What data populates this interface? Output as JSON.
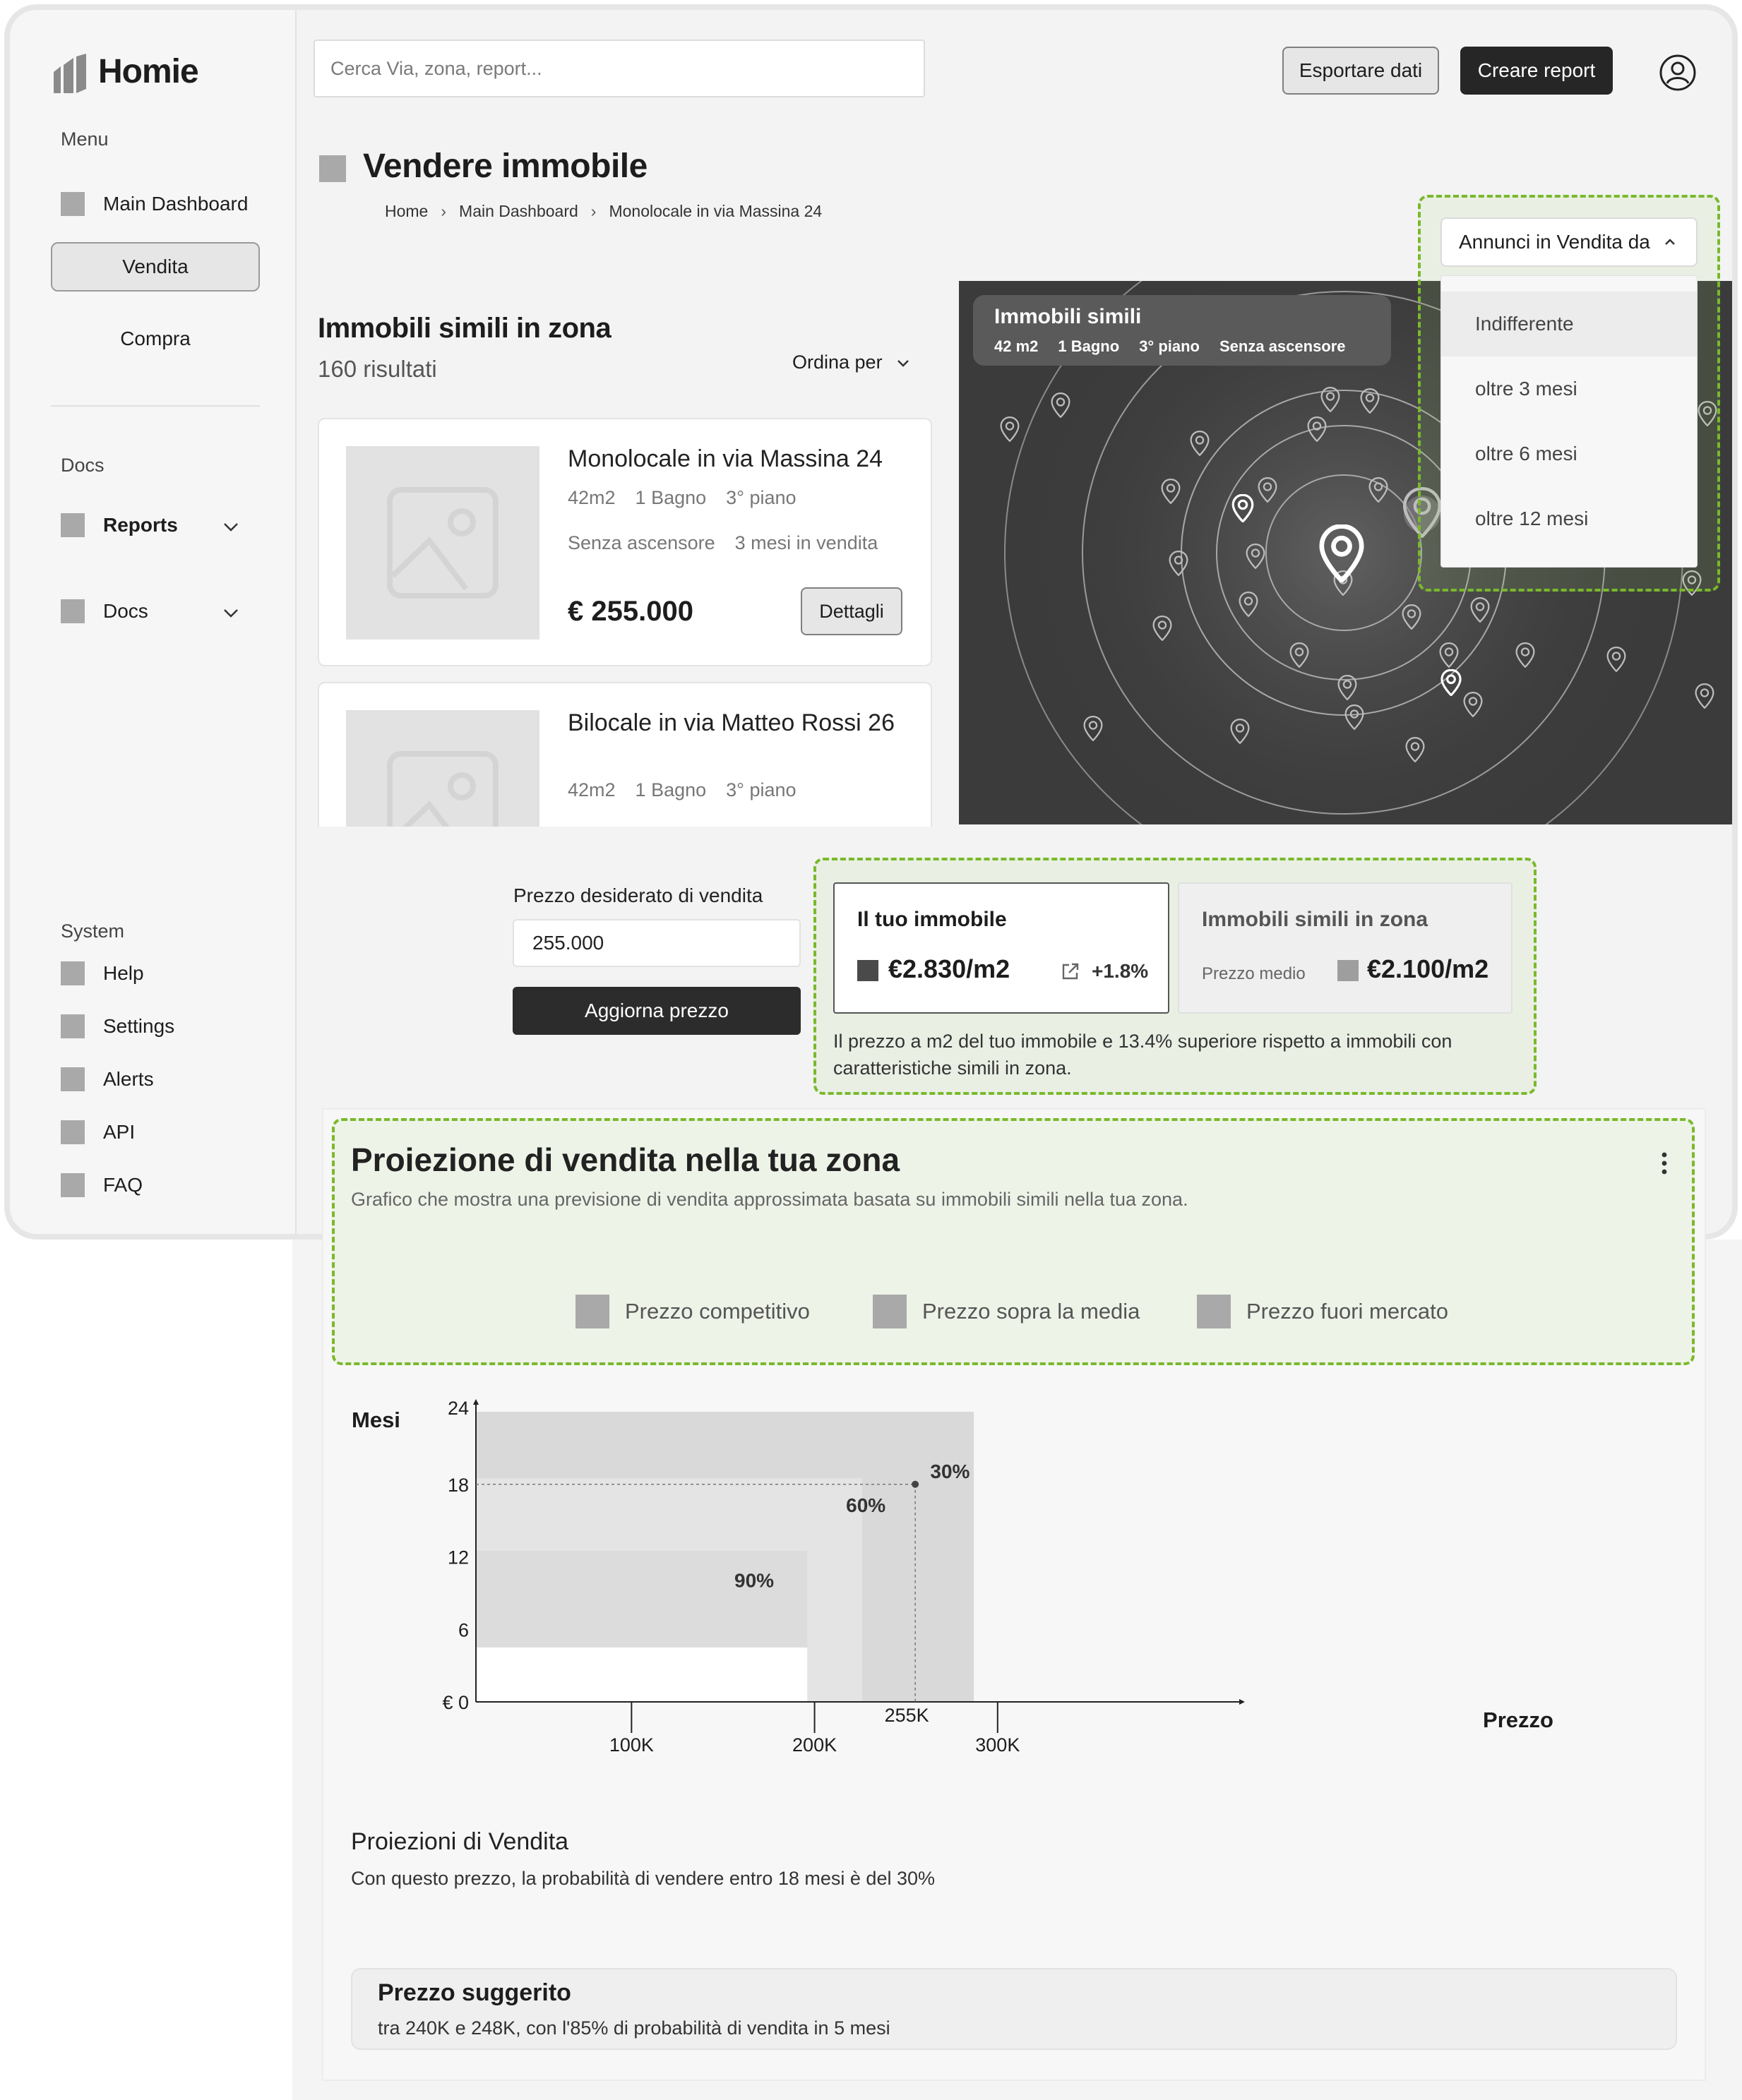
{
  "app": {
    "name": "Homie"
  },
  "sidebar": {
    "menu_label": "Menu",
    "items": [
      {
        "label": "Main Dashboard"
      },
      {
        "label": "Vendita"
      },
      {
        "label": "Compra"
      }
    ],
    "docs_label": "Docs",
    "docs_items": [
      {
        "label": "Reports"
      },
      {
        "label": "Docs"
      }
    ],
    "system_label": "System",
    "system_items": [
      {
        "label": "Help"
      },
      {
        "label": "Settings"
      },
      {
        "label": "Alerts"
      },
      {
        "label": "API"
      },
      {
        "label": "FAQ"
      }
    ]
  },
  "header": {
    "search_placeholder": "Cerca Via, zona, report...",
    "export_label": "Esportare dati",
    "report_label": "Creare report"
  },
  "page": {
    "title": "Vendere immobile",
    "breadcrumb": [
      "Home",
      "Main Dashboard",
      "Monolocale in via Massina 24"
    ]
  },
  "listing": {
    "title": "Immobili simili in zona",
    "results": "160 risultati",
    "sort_label": "Ordina per",
    "cards": [
      {
        "title": "Monolocale in via Massina 24",
        "size": "42m2",
        "bath": "1 Bagno",
        "floor": "3° piano",
        "elevator": "Senza ascensore",
        "months": "3 mesi in vendita",
        "price": "€ 255.000",
        "details": "Dettagli"
      },
      {
        "title": "Bilocale in via  Matteo Rossi 26",
        "size": "42m2",
        "bath": "1 Bagno",
        "floor": "3° piano"
      }
    ]
  },
  "map": {
    "card_title": "Immobili simili",
    "tags": [
      "42 m2",
      "1 Bagno",
      "3° piano",
      "Senza ascensore"
    ]
  },
  "filter": {
    "label": "Annunci in Vendita da",
    "options": [
      "Indifferente",
      "oltre 3 mesi",
      "oltre 6 mesi",
      "oltre 12 mesi"
    ],
    "highlighted": "Indifferente"
  },
  "pricing": {
    "input_label": "Prezzo desiderato di vendita",
    "input_value": "255.000",
    "update_label": "Aggiorna prezzo",
    "yours_title": "Il tuo immobile",
    "yours_value": "€2.830/m2",
    "yours_change": "+1.8%",
    "zone_title": "Immobili simili in zona",
    "zone_caption": "Prezzo medio",
    "zone_value": "€2.100/m2",
    "note": "Il prezzo a m2 del tuo immobile e 13.4% superiore rispetto a immobili con caratteristiche simili in zona."
  },
  "projection": {
    "title": "Proiezione di vendita nella tua zona",
    "subtitle": "Grafico che mostra una previsione di vendita approssimata basata su immobili simili nella tua zona.",
    "legend": [
      "Prezzo competitivo",
      "Prezzo sopra la media",
      "Prezzo fuori mercato"
    ],
    "summary_title": "Proiezioni di Vendita",
    "summary_text": "Con questo prezzo, la probabilità di vendere entro 18 mesi è del 30%",
    "suggested_title": "Prezzo suggerito",
    "suggested_text": "tra 240K e 248K, con l'85% di probabilità di vendita in 5 mesi"
  },
  "chart_data": {
    "type": "area",
    "xlabel": "Prezzo",
    "ylabel": "Mesi",
    "x_ticks": [
      "100K",
      "200K",
      "300K"
    ],
    "x_tick_values": [
      100,
      200,
      300
    ],
    "y_ticks": [
      "€ 0",
      "6",
      "12",
      "18",
      "24"
    ],
    "y_tick_values": [
      0,
      6,
      12,
      18,
      24
    ],
    "xlim": [
      15,
      378
    ],
    "ylim": [
      0,
      24
    ],
    "bands": [
      {
        "label": "90%",
        "x_end": 196,
        "y_min": 4.5,
        "y_max": 12.5,
        "x_label": 167,
        "y_label": 9.5
      },
      {
        "label": "60%",
        "x_end": 226,
        "y_min": 0,
        "y_max": 18.5,
        "x_label": 228,
        "y_label": 15.7
      },
      {
        "label": "30%",
        "x_end": 287,
        "y_min": 0,
        "y_max": 24,
        "x_label": 274,
        "y_label": 18.5
      }
    ],
    "marker": {
      "x": 255,
      "y": 18,
      "label": "255K"
    },
    "colors": {
      "band_90": "#dedede",
      "band_60": "#e8e8e8",
      "band_30": "#e0e0e0"
    }
  }
}
